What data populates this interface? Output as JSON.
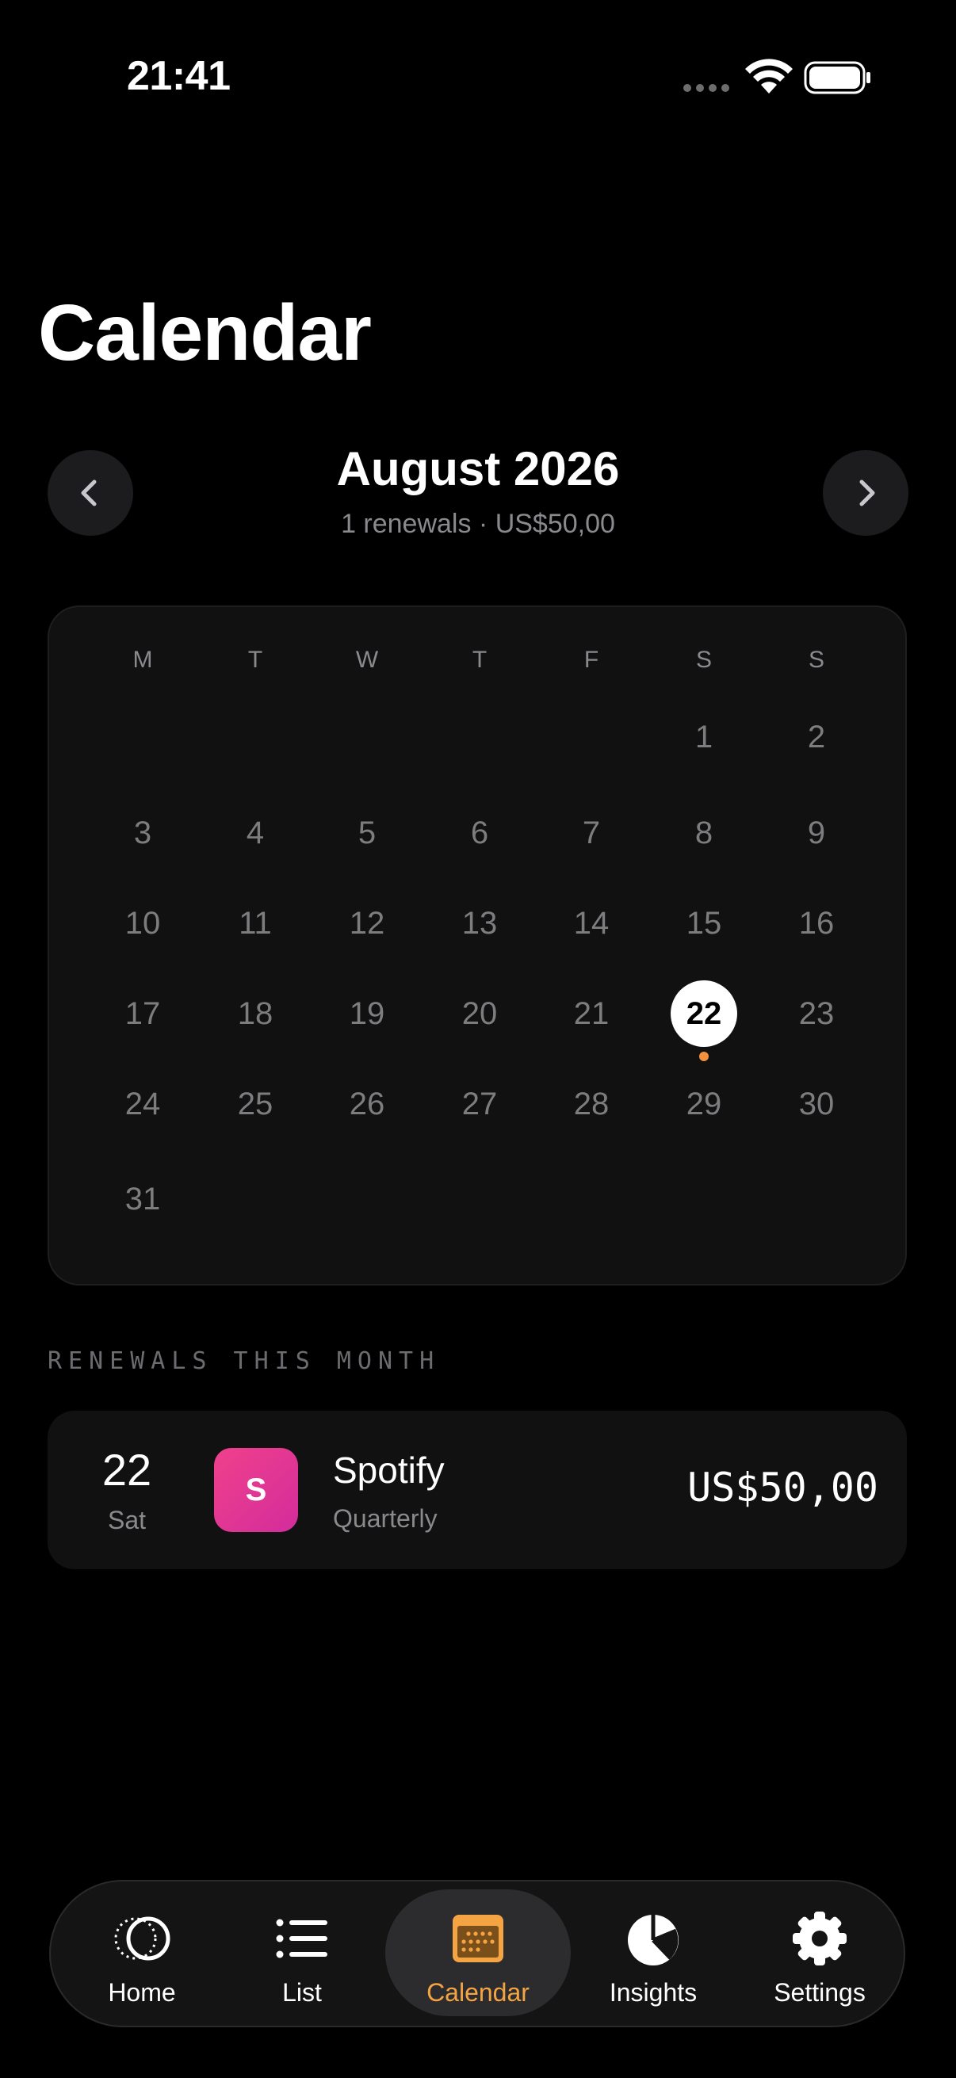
{
  "status_bar": {
    "time": "21:41"
  },
  "page": {
    "title": "Calendar"
  },
  "month_nav": {
    "title": "August 2026",
    "summary": "1 renewals · US$50,00"
  },
  "calendar": {
    "weekdays": [
      "M",
      "T",
      "W",
      "T",
      "F",
      "S",
      "S"
    ],
    "weeks": [
      [
        "",
        "",
        "",
        "",
        "",
        "1",
        "2"
      ],
      [
        "3",
        "4",
        "5",
        "6",
        "7",
        "8",
        "9"
      ],
      [
        "10",
        "11",
        "12",
        "13",
        "14",
        "15",
        "16"
      ],
      [
        "17",
        "18",
        "19",
        "20",
        "21",
        "22",
        "23"
      ],
      [
        "24",
        "25",
        "26",
        "27",
        "28",
        "29",
        "30"
      ],
      [
        "31",
        "",
        "",
        "",
        "",
        "",
        ""
      ]
    ],
    "selected_day": "22",
    "renewal_days": [
      "22"
    ],
    "accent_color": "#f5913e"
  },
  "renewals": {
    "section_title": "RENEWALS THIS MONTH",
    "items": [
      {
        "day": "22",
        "weekday": "Sat",
        "initial": "S",
        "name": "Spotify",
        "cycle": "Quarterly",
        "amount": "US$50,00"
      }
    ]
  },
  "tab_bar": {
    "active_color": "#f5a443",
    "tabs": [
      {
        "label": "Home",
        "icon": "home-circles-icon",
        "active": false
      },
      {
        "label": "List",
        "icon": "list-icon",
        "active": false
      },
      {
        "label": "Calendar",
        "icon": "calendar-icon",
        "active": true
      },
      {
        "label": "Insights",
        "icon": "pie-chart-icon",
        "active": false
      },
      {
        "label": "Settings",
        "icon": "gear-icon",
        "active": false
      }
    ]
  }
}
